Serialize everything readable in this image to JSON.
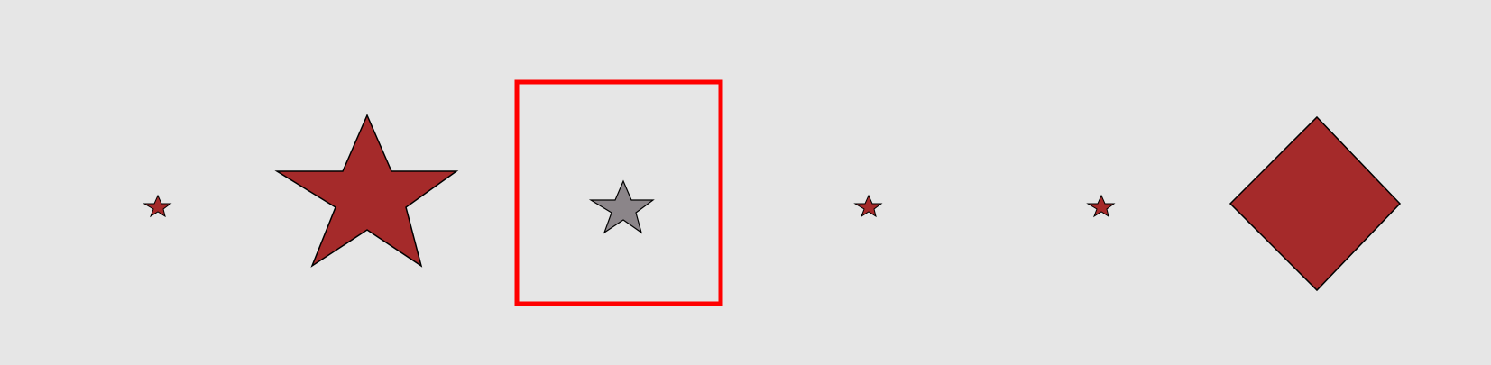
{
  "colors": {
    "background": "#e6e6e6",
    "shape_fill": "#a52a2a",
    "selected_fill": "#8b8589",
    "selection_outline": "#ff0000",
    "stroke": "#000000"
  },
  "shapes": [
    {
      "type": "star",
      "size": "small",
      "selected": false
    },
    {
      "type": "star",
      "size": "large",
      "selected": false
    },
    {
      "type": "star",
      "size": "medium",
      "selected": true
    },
    {
      "type": "star",
      "size": "small",
      "selected": false
    },
    {
      "type": "star",
      "size": "small",
      "selected": false
    },
    {
      "type": "diamond",
      "size": "large",
      "selected": false
    }
  ]
}
